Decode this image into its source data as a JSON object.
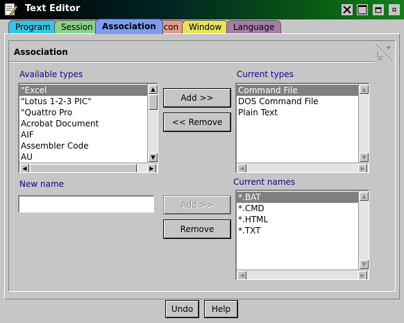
{
  "window": {
    "title": "Text Editor"
  },
  "tabs": [
    {
      "label": "Program",
      "color": "#36c4e6"
    },
    {
      "label": "Session",
      "color": "#8cd286"
    },
    {
      "label": "Association",
      "color": "#7b9cf2"
    },
    {
      "label": "Icon",
      "color": "#e79a8a"
    },
    {
      "label": "Window",
      "color": "#e6e45a"
    },
    {
      "label": "Language",
      "color": "#a77ca6"
    }
  ],
  "section": {
    "title": "Association"
  },
  "available": {
    "label": "Available types",
    "items": [
      "\"Excel",
      "\"Lotus 1-2-3 PIC\"",
      "\"Quattro Pro",
      "Acrobat Document",
      "AIF",
      "Assembler Code",
      "AU"
    ]
  },
  "current_types": {
    "label": "Current types",
    "items": [
      "Command File",
      "DOS Command File",
      "Plain Text"
    ]
  },
  "new_name": {
    "label": "New name",
    "value": ""
  },
  "current_names": {
    "label": "Current names",
    "items": [
      "*.BAT",
      "*.CMD",
      "*.HTML",
      "*.TXT"
    ]
  },
  "buttons": {
    "add_types": "Add >>",
    "remove_types": "<< Remove",
    "add_names": "Add >>",
    "remove_names": "Remove",
    "undo": "Undo",
    "help": "Help"
  },
  "icons": {
    "app": "text-editor-icon",
    "close": "close-icon",
    "maximize": "maximize-icon",
    "minimize": "minimize-icon",
    "menu": "window-menu-icon",
    "corner": "page-corner-icon"
  }
}
